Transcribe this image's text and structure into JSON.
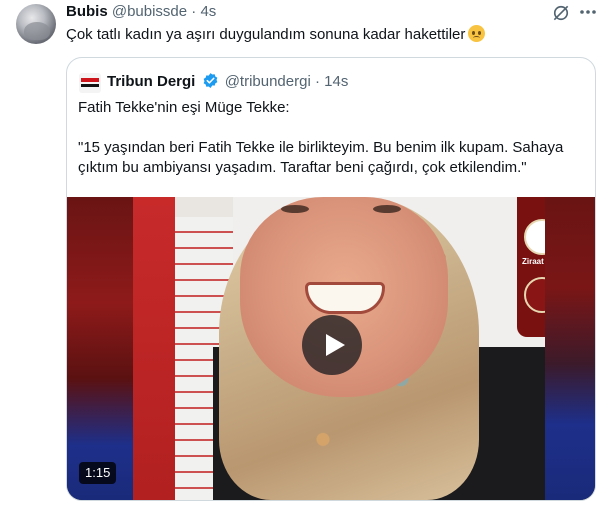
{
  "tweet": {
    "author_name": "Bubis",
    "author_handle": "@bubissde",
    "separator": "·",
    "time": "4s",
    "text": "Çok tatlı kadın ya aşırı duygulandım sonuna kadar hakettiler",
    "icons": {
      "mute": "mute-icon",
      "more": "more-icon",
      "emoji": "pleading-face-emoji"
    }
  },
  "quote": {
    "author_name": "Tribun Dergi",
    "author_handle": "@tribundergi",
    "separator": "·",
    "time": "14s",
    "line1": "Fatih Tekke'nin eşi Müge Tekke:",
    "line2": "\"15 yaşından beri Fatih Tekke ile birlikteyim. Bu benim ilk kupam. Sahaya çıktım bu ambiyansı yaşadım. Taraftar beni çağırdı, çok etkilendim.\"",
    "video": {
      "duration": "1:15",
      "banner_text": "Ziraat"
    }
  },
  "colors": {
    "verified": "#1d9bf0",
    "muted_text": "#536471",
    "border": "#cfd9de"
  }
}
